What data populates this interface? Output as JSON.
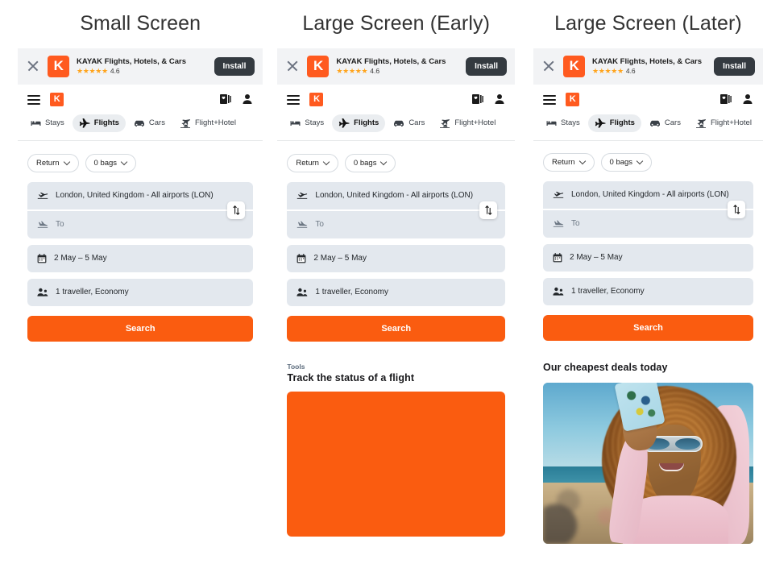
{
  "columns": [
    {
      "title": "Small Screen",
      "variant": "small",
      "sections": []
    },
    {
      "title": "Large Screen (Early)",
      "variant": "early",
      "sections": [
        {
          "eyebrow": "Tools",
          "heading": "Track the status of a flight",
          "media": "orange-placeholder"
        }
      ]
    },
    {
      "title": "Large Screen (Later)",
      "variant": "later",
      "sections": [
        {
          "eyebrow": "",
          "heading": "Our cheapest deals today",
          "media": "beach-photo"
        }
      ]
    }
  ],
  "install_banner": {
    "close_label": "Close",
    "logo_letter": "K",
    "app_name": "KAYAK Flights, Hotels, & Cars",
    "stars": "★★★★★",
    "rating": "4.6",
    "install_label": "Install"
  },
  "topnav": {
    "menu_label": "Menu",
    "logo_letter": "K",
    "trips_label": "Trips",
    "account_label": "Account"
  },
  "tabs": [
    {
      "label": "Stays",
      "icon": "bed-icon",
      "active": false
    },
    {
      "label": "Flights",
      "icon": "plane-icon",
      "active": true
    },
    {
      "label": "Cars",
      "icon": "car-icon",
      "active": false
    },
    {
      "label": "Flight+Hotel",
      "icon": "flight-hotel-icon",
      "active": false
    }
  ],
  "search_form": {
    "trip_type": "Return",
    "bags": "0 bags",
    "origin_value": "London, United Kingdom - All airports (LON)",
    "destination_placeholder": "To",
    "dates": "2 May – 5 May",
    "travellers": "1 traveller, Economy",
    "swap_label": "Swap origin and destination",
    "search_label": "Search"
  },
  "colors": {
    "brand_orange": "#fa5c10",
    "logo_orange": "#ff5a1f",
    "field_bg": "#e3e8ee",
    "banner_bg": "#f2f3f5",
    "install_btn": "#343a40",
    "star_gold": "#ffa41c",
    "eyebrow": "#5b6b7c"
  }
}
